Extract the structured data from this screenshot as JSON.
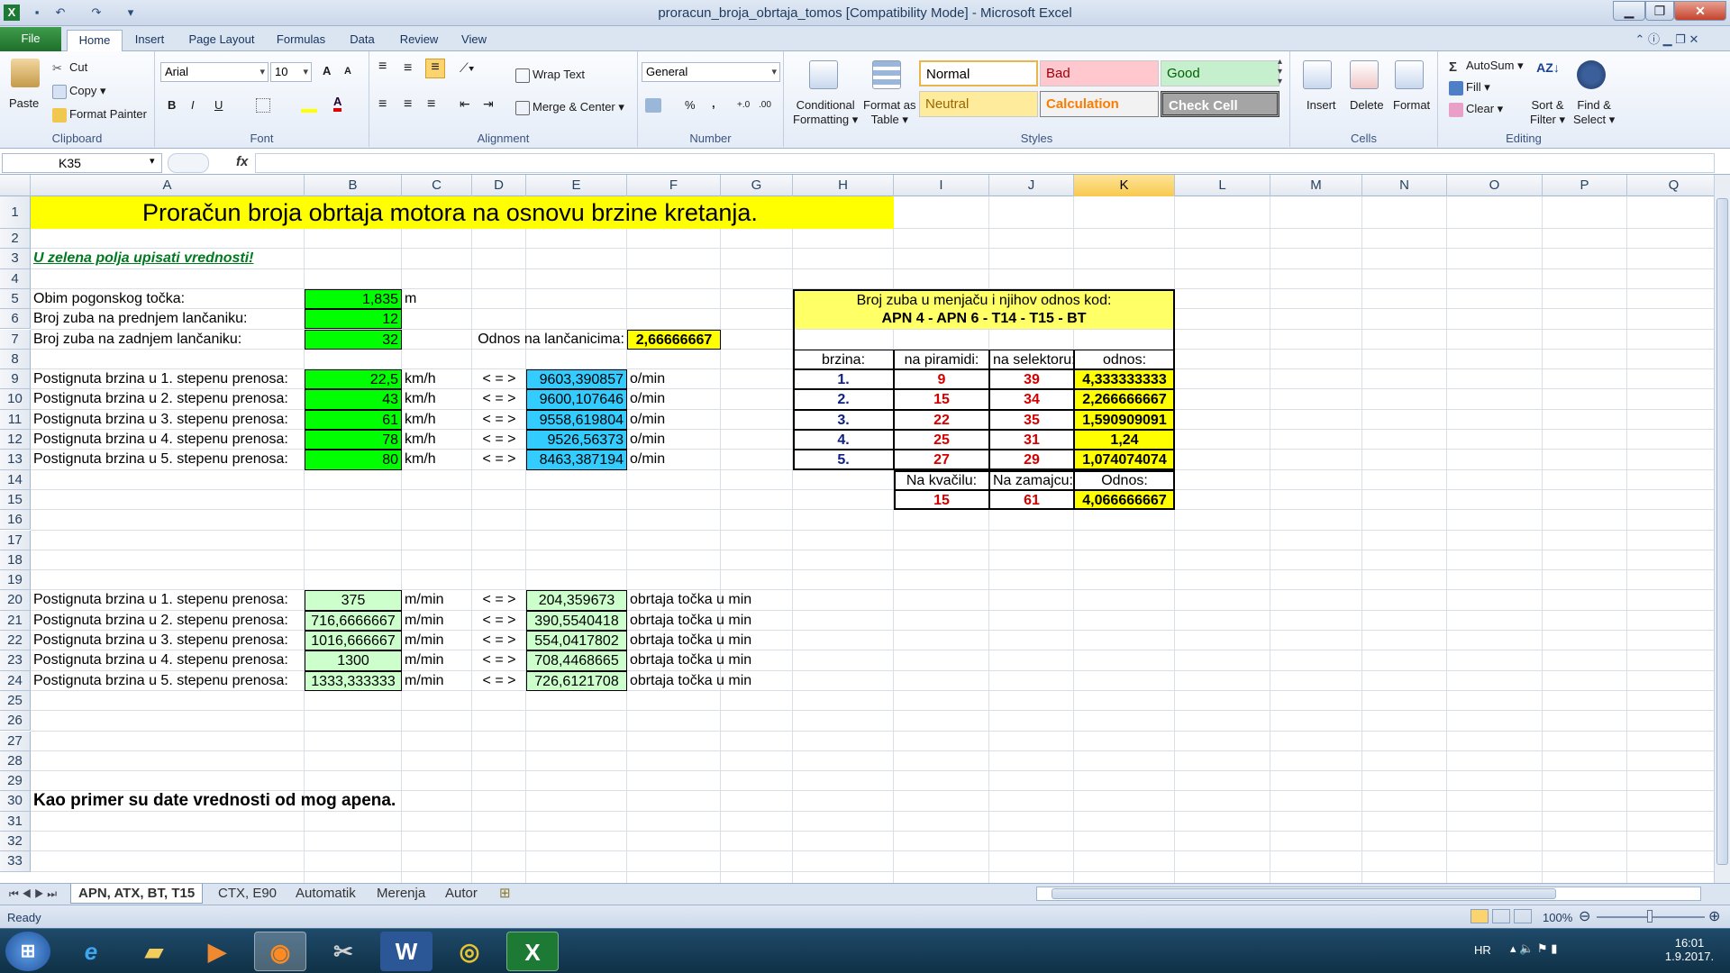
{
  "window": {
    "title": "proracun_broja_obrtaja_tomos  [Compatibility Mode] - Microsoft Excel",
    "minimize": "▁",
    "maximize": "❐",
    "close": "✕"
  },
  "ribbon_tabs": [
    "File",
    "Home",
    "Insert",
    "Page Layout",
    "Formulas",
    "Data",
    "Review",
    "View"
  ],
  "clipboard": {
    "paste": "Paste",
    "cut": "Cut",
    "copy": "Copy ▾",
    "format_painter": "Format Painter",
    "label": "Clipboard"
  },
  "font": {
    "name": "Arial",
    "size": "10",
    "grow": "A",
    "shrink": "A",
    "bold": "B",
    "italic": "I",
    "underline": "U",
    "label": "Font"
  },
  "alignment": {
    "wrap": "Wrap Text",
    "merge": "Merge & Center",
    "label": "Alignment"
  },
  "number": {
    "format": "General",
    "percent": "%",
    "comma": ",",
    "inc": "+.0",
    "dec": ".00",
    "label": "Number"
  },
  "styles": {
    "conditional": "Conditional",
    "conditional2": "Formatting ▾",
    "format_table": "Format as",
    "format_table2": "Table ▾",
    "normal": "Normal",
    "bad": "Bad",
    "good": "Good",
    "neutral": "Neutral",
    "calculation": "Calculation",
    "check": "Check Cell",
    "label": "Styles"
  },
  "cells_group": {
    "insert": "Insert",
    "delete": "Delete",
    "format": "Format",
    "label": "Cells"
  },
  "editing": {
    "autosum": "AutoSum ▾",
    "fill": "Fill ▾",
    "clear": "Clear ▾",
    "sort": "Sort &",
    "sort2": "Filter ▾",
    "find": "Find &",
    "find2": "Select ▾",
    "label": "Editing"
  },
  "namebox": "K35",
  "fx": "fx",
  "columns": [
    "A",
    "B",
    "C",
    "D",
    "E",
    "F",
    "G",
    "H",
    "I",
    "J",
    "K",
    "L",
    "M",
    "N",
    "O",
    "P",
    "Q",
    "R"
  ],
  "rows": [
    "1",
    "2",
    "3",
    "4",
    "5",
    "6",
    "7",
    "8",
    "9",
    "10",
    "11",
    "12",
    "13",
    "14",
    "15",
    "16",
    "17",
    "18",
    "19",
    "20",
    "21",
    "22",
    "23",
    "24",
    "25",
    "26",
    "27",
    "28",
    "29",
    "30",
    "31",
    "32",
    "33"
  ],
  "sheet": {
    "title": "Proračun broja obrtaja motora na osnovu brzine kretanja.",
    "instruction": "U zelena polja upisati vrednosti!",
    "obim_label": "Obim pogonskog točka:",
    "obim_value": "1,835",
    "obim_unit": "m",
    "prednji_label": "Broj zuba na prednjem lančaniku:",
    "prednji_value": "12",
    "zadnji_label": "Broj zuba na zadnjem lančaniku:",
    "zadnji_value": "32",
    "odnos_lanc_label": "Odnos na lančanicima:",
    "odnos_lanc_value": "2,66666667",
    "kmh_rows": [
      {
        "label": "Postignuta brzina u 1. stepenu prenosa:",
        "speed": "22,5",
        "unit": "km/h",
        "arrow": "< = >",
        "rpm": "9603,390857",
        "rpm_unit": "o/min"
      },
      {
        "label": "Postignuta brzina u 2. stepenu prenosa:",
        "speed": "43",
        "unit": "km/h",
        "arrow": "< = >",
        "rpm": "9600,107646",
        "rpm_unit": "o/min"
      },
      {
        "label": "Postignuta brzina u 3. stepenu prenosa:",
        "speed": "61",
        "unit": "km/h",
        "arrow": "< = >",
        "rpm": "9558,619804",
        "rpm_unit": "o/min"
      },
      {
        "label": "Postignuta brzina u 4. stepenu prenosa:",
        "speed": "78",
        "unit": "km/h",
        "arrow": "< = >",
        "rpm": "9526,56373",
        "rpm_unit": "o/min"
      },
      {
        "label": "Postignuta brzina u 5. stepenu prenosa:",
        "speed": "80",
        "unit": "km/h",
        "arrow": "< = >",
        "rpm": "8463,387194",
        "rpm_unit": "o/min"
      }
    ],
    "mmin_rows": [
      {
        "label": "Postignuta brzina u 1. stepenu prenosa:",
        "speed": "375",
        "unit": "m/min",
        "arrow": "< = >",
        "rot": "204,359673",
        "rot_unit": "obrtaja točka u min"
      },
      {
        "label": "Postignuta brzina u 2. stepenu prenosa:",
        "speed": "716,6666667",
        "unit": "m/min",
        "arrow": "< = >",
        "rot": "390,5540418",
        "rot_unit": "obrtaja točka u min"
      },
      {
        "label": "Postignuta brzina u 3. stepenu prenosa:",
        "speed": "1016,666667",
        "unit": "m/min",
        "arrow": "< = >",
        "rot": "554,0417802",
        "rot_unit": "obrtaja točka u min"
      },
      {
        "label": "Postignuta brzina u 4. stepenu prenosa:",
        "speed": "1300",
        "unit": "m/min",
        "arrow": "< = >",
        "rot": "708,4468665",
        "rot_unit": "obrtaja točka u min"
      },
      {
        "label": "Postignuta brzina u 5. stepenu prenosa:",
        "speed": "1333,333333",
        "unit": "m/min",
        "arrow": "< = >",
        "rot": "726,6121708",
        "rot_unit": "obrtaja točka u min"
      }
    ],
    "gear_table": {
      "title1": "Broj zuba u menjaču i njihov odnos kod:",
      "title2": "APN 4 - APN 6 - T14 - T15 - BT",
      "headers": [
        "brzina:",
        "na piramidi:",
        "na selektoru:",
        "odnos:"
      ],
      "rows": [
        [
          "1.",
          "9",
          "39",
          "4,333333333"
        ],
        [
          "2.",
          "15",
          "34",
          "2,266666667"
        ],
        [
          "3.",
          "22",
          "35",
          "1,590909091"
        ],
        [
          "4.",
          "25",
          "31",
          "1,24"
        ],
        [
          "5.",
          "27",
          "29",
          "1,074074074"
        ]
      ]
    },
    "chain_table": {
      "headers": [
        "Na kvačilu:",
        "Na zamajcu:",
        "Odnos:"
      ],
      "values": [
        "15",
        "61",
        "4,066666667"
      ]
    },
    "note": "Kao primer su date vrednosti od mog apena."
  },
  "sheet_tabs": [
    "APN, ATX, BT, T15",
    "CTX, E90",
    "Automatik",
    "Merenja",
    "Autor"
  ],
  "status": {
    "ready": "Ready",
    "zoom": "100%"
  },
  "tray": {
    "lang": "HR",
    "time": "16:01",
    "date": "1.9.2017."
  }
}
